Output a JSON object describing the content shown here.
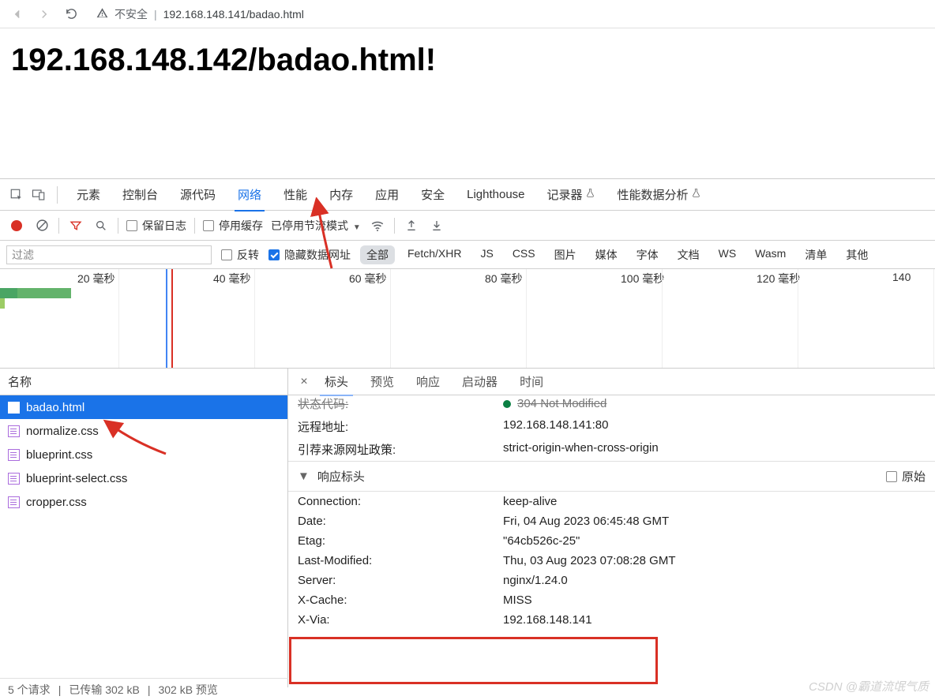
{
  "browser": {
    "insecure_label": "不安全",
    "url": "192.168.148.141/badao.html"
  },
  "page": {
    "heading": "192.168.148.142/badao.html!"
  },
  "devtools": {
    "tabs": [
      "元素",
      "控制台",
      "源代码",
      "网络",
      "性能",
      "内存",
      "应用",
      "安全",
      "Lighthouse",
      "记录器",
      "性能数据分析"
    ],
    "active_tab_index": 3,
    "toolbar": {
      "preserve_log": "保留日志",
      "disable_cache": "停用缓存",
      "throttle_text": "已停用节流模式"
    },
    "filter": {
      "placeholder": "过滤",
      "invert": "反转",
      "hide_data_urls": "隐藏数据网址",
      "types": [
        "全部",
        "Fetch/XHR",
        "JS",
        "CSS",
        "图片",
        "媒体",
        "字体",
        "文档",
        "WS",
        "Wasm",
        "清单",
        "其他"
      ]
    },
    "timeline": {
      "labels": [
        "20 毫秒",
        "40 毫秒",
        "60 毫秒",
        "80 毫秒",
        "100 毫秒",
        "120 毫秒",
        "140"
      ]
    },
    "requests": {
      "column_name": "名称",
      "items": [
        {
          "name": "badao.html",
          "type": "doc",
          "selected": true
        },
        {
          "name": "normalize.css",
          "type": "css",
          "selected": false
        },
        {
          "name": "blueprint.css",
          "type": "css",
          "selected": false
        },
        {
          "name": "blueprint-select.css",
          "type": "css",
          "selected": false
        },
        {
          "name": "cropper.css",
          "type": "css",
          "selected": false
        }
      ]
    },
    "detail_tabs": [
      "标头",
      "预览",
      "响应",
      "启动器",
      "时间"
    ],
    "detail_active_index": 0,
    "general": {
      "status_code_label": "状态代码:",
      "status_code_value": "304 Not Modified",
      "remote_addr_label": "远程地址:",
      "remote_addr_value": "192.168.148.141:80",
      "referrer_label": "引荐来源网址政策:",
      "referrer_value": "strict-origin-when-cross-origin"
    },
    "response_headers": {
      "section_title": "响应标头",
      "raw_label": "原始",
      "rows": [
        {
          "k": "Connection:",
          "v": "keep-alive"
        },
        {
          "k": "Date:",
          "v": "Fri, 04 Aug 2023 06:45:48 GMT"
        },
        {
          "k": "Etag:",
          "v": "\"64cb526c-25\""
        },
        {
          "k": "Last-Modified:",
          "v": "Thu, 03 Aug 2023 07:08:28 GMT"
        },
        {
          "k": "Server:",
          "v": "nginx/1.24.0"
        },
        {
          "k": "X-Cache:",
          "v": "MISS"
        },
        {
          "k": "X-Via:",
          "v": "192.168.148.141"
        }
      ]
    },
    "footer": {
      "requests": "5 个请求",
      "transferred": "已传输 302 kB",
      "resources": "302 kB 预览"
    }
  },
  "watermark": "CSDN @霸道流氓气质"
}
